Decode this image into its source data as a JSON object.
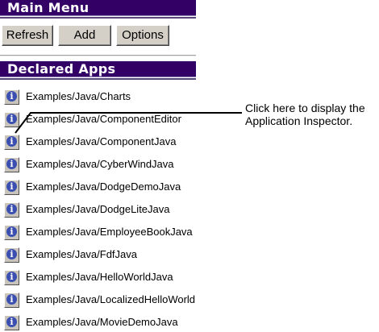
{
  "main_menu": {
    "title": "Main Menu",
    "buttons": {
      "refresh": "Refresh",
      "add": "Add",
      "options": "Options"
    }
  },
  "declared_apps": {
    "title": "Declared Apps",
    "items": [
      {
        "label": "Examples/Java/Charts",
        "icon": "info-icon"
      },
      {
        "label": "Examples/Java/ComponentEditor",
        "icon": "info-icon"
      },
      {
        "label": "Examples/Java/ComponentJava",
        "icon": "info-icon"
      },
      {
        "label": "Examples/Java/CyberWindJava",
        "icon": "info-icon"
      },
      {
        "label": "Examples/Java/DodgeDemoJava",
        "icon": "info-icon"
      },
      {
        "label": "Examples/Java/DodgeLiteJava",
        "icon": "info-icon"
      },
      {
        "label": "Examples/Java/EmployeeBookJava",
        "icon": "info-icon"
      },
      {
        "label": "Examples/Java/FdfJava",
        "icon": "info-icon"
      },
      {
        "label": "Examples/Java/HelloWorldJava",
        "icon": "info-icon"
      },
      {
        "label": "Examples/Java/LocalizedHelloWorld",
        "icon": "info-icon"
      },
      {
        "label": "Examples/Java/MovieDemoJava",
        "icon": "info-icon"
      }
    ]
  },
  "callout": {
    "line1": "Click here to display the",
    "line2": "Application Inspector."
  },
  "colors": {
    "header_bg": "#330066",
    "header_text": "#ffffff",
    "button_face": "#d4d0c8",
    "info_icon": "#3a4fb0"
  }
}
